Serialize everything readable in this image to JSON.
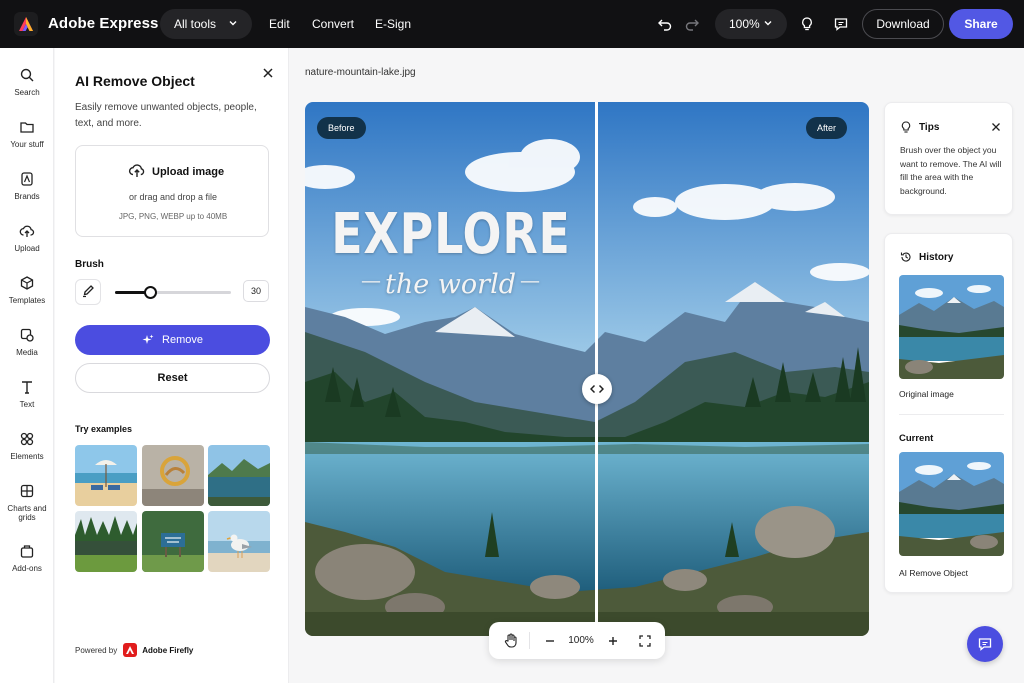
{
  "app": {
    "brand": "Adobe Express",
    "all_tools": "All tools",
    "nav": [
      "Edit",
      "Convert",
      "E-Sign"
    ],
    "zoom": "100%",
    "download": "Download",
    "share": "Share",
    "accent": "#5258e4"
  },
  "rail": [
    {
      "label": "Search",
      "icon": "search-icon"
    },
    {
      "label": "Your stuff",
      "icon": "folder-icon"
    },
    {
      "label": "Brands",
      "icon": "brand-icon"
    },
    {
      "label": "Upload",
      "icon": "upload-icon"
    },
    {
      "label": "Templates",
      "icon": "templates-icon"
    },
    {
      "label": "Media",
      "icon": "media-icon"
    },
    {
      "label": "Text",
      "icon": "text-icon"
    },
    {
      "label": "Elements",
      "icon": "elements-icon"
    },
    {
      "label": "Charts and grids",
      "icon": "charts-icon"
    },
    {
      "label": "Add-ons",
      "icon": "addons-icon"
    }
  ],
  "panel": {
    "title": "AI Remove Object",
    "description": "Easily remove unwanted objects, people, text, and more.",
    "upload": {
      "label": "Upload image",
      "sub": "or drag and drop a file",
      "types": "JPG, PNG, WEBP up to 40MB"
    },
    "brush": {
      "label": "Brush",
      "value": "30",
      "level": 0.3
    },
    "remove_label": "Remove",
    "reset_label": "Reset",
    "examples_label": "Try examples",
    "powered_by": "Powered by",
    "powered_name": "Adobe Firefly"
  },
  "canvas": {
    "filename": "nature-mountain-lake.jpg",
    "before_label": "Before",
    "after_label": "After",
    "overlay_title": "EXPLORE",
    "overlay_subtitle": "the world",
    "zoom": "100%"
  },
  "tips": {
    "title": "Tips",
    "body": "Brush over the object you want to remove. The AI will fill the area with the background."
  },
  "history": {
    "title": "History",
    "original_label": "Original image",
    "current_title": "Current",
    "current_label": "AI Remove Object"
  }
}
